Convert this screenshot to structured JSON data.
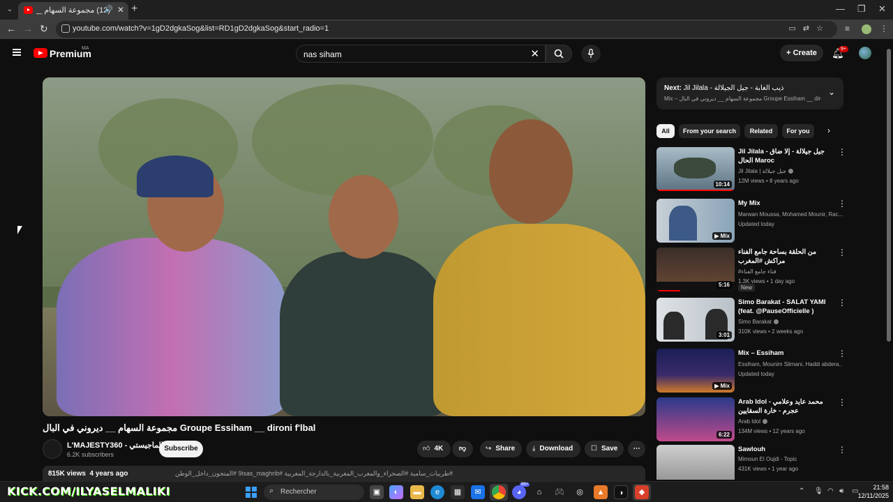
{
  "browser": {
    "tab_title": "(12) مجموعة السهام __ ديرو",
    "url": "youtube.com/watch?v=1gD2dgkaSog&list=RD1gD2dgkaSog&start_radio=1"
  },
  "header": {
    "brand": "Premium",
    "region": "MA",
    "search_query": "nas siham",
    "create_label": "Create",
    "notif_count": "9+"
  },
  "video": {
    "title": "مجموعة السهام __ ديروني في البال Groupe Essiham __ dironi f'lbal",
    "channel_name": "L'MAJESTY360 - الماجيستي",
    "subscribers": "6.2K subscribers",
    "subscribe_label": "Subscribe",
    "likes": "4K",
    "share_label": "Share",
    "download_label": "Download",
    "save_label": "Save",
    "views": "815K views",
    "age": "4 years ago",
    "tags": "#طربيات_سامية #الصحراء_والمغرب_المغربية_بالدارجة_المغربية #9isas_maghrib #المتجون_داخل_الوطن"
  },
  "next": {
    "label": "Next:",
    "title": "Jil Jilala - ذيب الغابة - جيل الجيلالة",
    "sub": "Mix – مجموعة السهام __ ديروني في البال Groupe Essiham __ dironi f'l..."
  },
  "chips": [
    "All",
    "From your search",
    "Related",
    "For you"
  ],
  "recommendations": [
    {
      "title": "Jil Jilala - جيل جيلالة - إلا ضاق الحال Maroc",
      "channel": "Jil Jilala | جيل جيلالة",
      "verified": true,
      "meta": "12M views • 8 years ago",
      "duration": "10:14",
      "badge": ""
    },
    {
      "title": "My Mix",
      "channel": "Marwan Moussa, Mohamed Mounir, Rac...",
      "verified": false,
      "meta": "Updated today",
      "duration": "Mix",
      "badge": ""
    },
    {
      "title": "من الحلقة بساحة جامع الفناء مراكش #المغرب",
      "channel": "#فناء جامع الفناء",
      "verified": false,
      "meta": "1.3K views • 1 day ago",
      "duration": "5:16",
      "badge": "New"
    },
    {
      "title": "Simo Barakat - SALAT YAMI (feat. @PauseOfficielle )",
      "channel": "Simo Barakat",
      "verified": true,
      "meta": "310K views • 2 weeks ago",
      "duration": "3:01",
      "badge": ""
    },
    {
      "title": "Mix – Essiham",
      "channel": "Essiham, Mounim Slimani, Haddi abdera...",
      "verified": false,
      "meta": "Updated today",
      "duration": "Mix",
      "badge": ""
    },
    {
      "title": "Arab Idol - محمد عايد وعلامي عجرم - خارة السقايين",
      "channel": "Arab Idol",
      "verified": true,
      "meta": "134M views • 12 years ago",
      "duration": "6:22",
      "badge": ""
    },
    {
      "title": "Sawlouh",
      "channel": "Mimoun El Oujdi - Topic",
      "verified": false,
      "meta": "431K views • 1 year ago",
      "duration": "",
      "badge": ""
    }
  ],
  "taskbar": {
    "kick_text": "KICK.COM/ILYASELMALIKI",
    "search_placeholder": "Rechercher",
    "time": "21:58",
    "date": "12/11/2025",
    "discord_badge": "99+"
  },
  "colors": {
    "accent_red": "#ff0000",
    "background": "#0f0f0f",
    "kick_green": "#53fc18"
  }
}
